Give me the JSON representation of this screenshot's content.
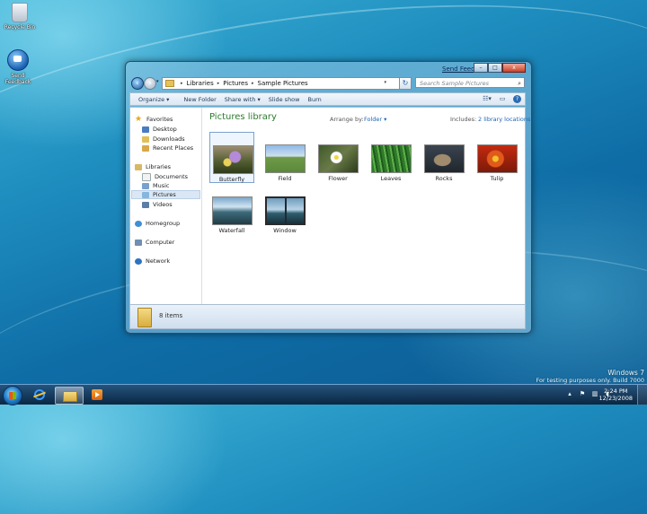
{
  "desktop": {
    "icons": [
      {
        "label": "Recycle Bin"
      },
      {
        "label": "Send Feedback"
      }
    ],
    "watermark": {
      "line1": "Windows 7",
      "line2": "For testing purposes only. Build 7000"
    }
  },
  "window": {
    "send_feedback": "Send Feedback",
    "caption_buttons": {
      "minimize": "–",
      "maximize": "□",
      "close": "x"
    },
    "breadcrumb": [
      "Libraries",
      "Pictures",
      "Sample Pictures"
    ],
    "search_placeholder": "Search Sample Pictures",
    "toolbar": {
      "organize": "Organize ▾",
      "new_folder": "New Folder",
      "share_with": "Share with ▾",
      "slide_show": "Slide show",
      "burn": "Burn"
    },
    "nav": {
      "favorites": "Favorites",
      "desktop": "Desktop",
      "downloads": "Downloads",
      "recent_places": "Recent Places",
      "libraries": "Libraries",
      "documents": "Documents",
      "music": "Music",
      "pictures": "Pictures",
      "videos": "Videos",
      "homegroup": "Homegroup",
      "computer": "Computer",
      "network": "Network",
      "selected": "Pictures"
    },
    "main": {
      "title": "Pictures library",
      "arrange_label": "Arrange by:",
      "arrange_value": "Folder ▾",
      "includes_label": "Includes:",
      "includes_link": "2 library locations",
      "items": [
        {
          "label": "Butterfly",
          "selected": true
        },
        {
          "label": "Field",
          "selected": false
        },
        {
          "label": "Flower",
          "selected": false
        },
        {
          "label": "Leaves",
          "selected": false
        },
        {
          "label": "Rocks",
          "selected": false
        },
        {
          "label": "Tulip",
          "selected": false
        },
        {
          "label": "Waterfall",
          "selected": false
        },
        {
          "label": "Window",
          "selected": false
        }
      ]
    },
    "details": {
      "count": "8 items"
    }
  },
  "taskbar": {
    "clock_time": "2:24 PM",
    "clock_date": "12/23/2008",
    "active_button": "Windows Explorer"
  },
  "colors": {
    "library_title": "#2e7a2e",
    "link": "#1c64b5",
    "desktop_bg": "#1f8fc0"
  }
}
